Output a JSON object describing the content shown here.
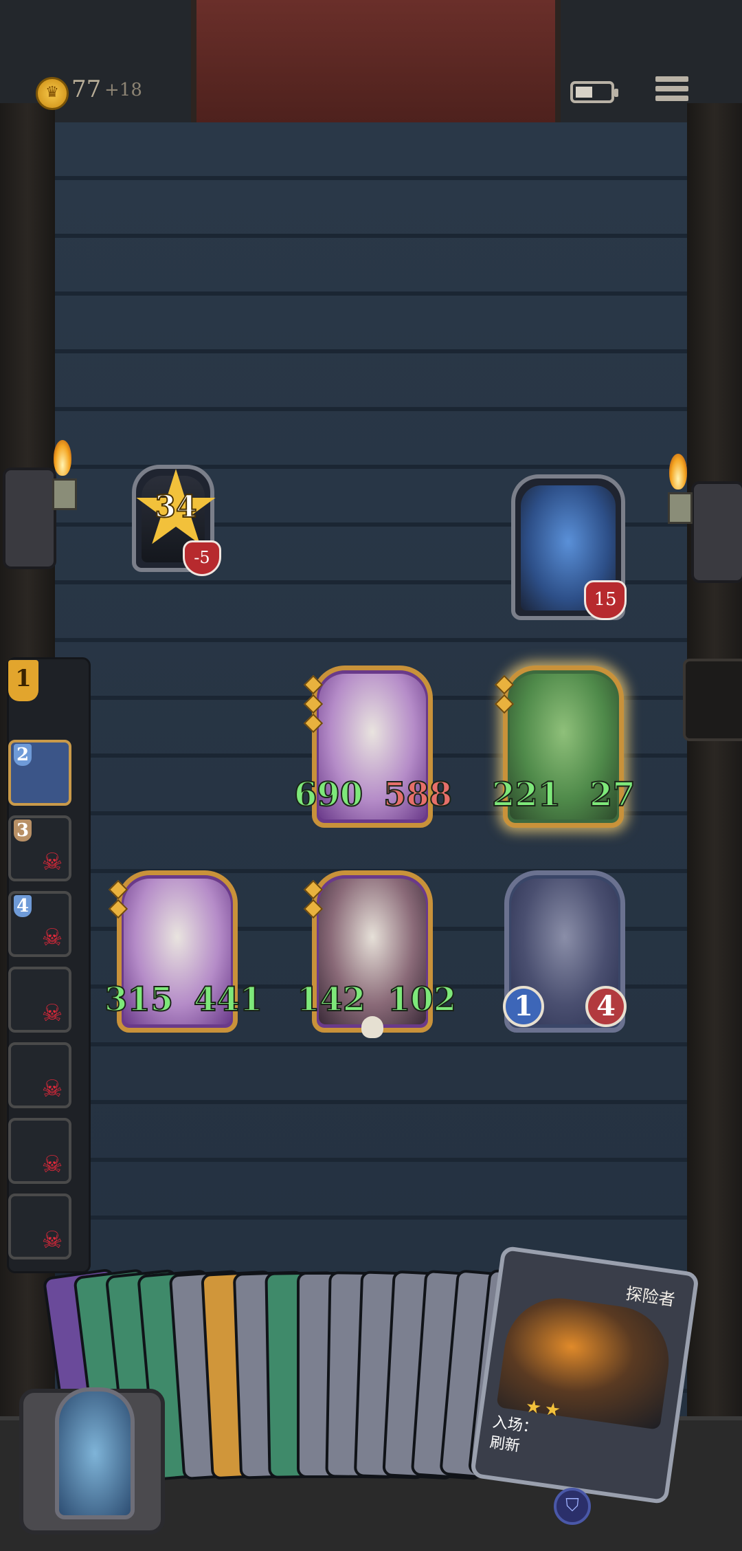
{
  "hud": {
    "gold": "77",
    "gold_delta": "+18",
    "battery_level": 0.5,
    "coin_icon": "crown-coin-icon",
    "menu_icon": "menu-icon"
  },
  "enemies": [
    {
      "name": "enemy-hooded",
      "star_value": "34",
      "heart": "-5"
    },
    {
      "name": "enemy-blue-ogre",
      "heart": "15"
    }
  ],
  "units": [
    {
      "id": "pumpkin-stack-1",
      "attack": "690",
      "health": "588",
      "style": "stat-text"
    },
    {
      "id": "green-bird",
      "attack": "221",
      "health": "27",
      "style": "stat-text"
    },
    {
      "id": "pumpkin-stack-2",
      "attack": "315",
      "health": "441",
      "style": "stat-text"
    },
    {
      "id": "masked-rabbit",
      "attack": "142",
      "health": "102",
      "style": "stat-text"
    },
    {
      "id": "gray-rat",
      "attack": "1",
      "health": "4",
      "style": "orbs"
    }
  ],
  "turn_queue": {
    "current": "1",
    "slots": [
      {
        "num": "2",
        "dead": false
      },
      {
        "num": "3",
        "dead": true
      },
      {
        "num": "4",
        "dead": true
      },
      {
        "num": "",
        "dead": true
      },
      {
        "num": "",
        "dead": true
      },
      {
        "num": "",
        "dead": true
      },
      {
        "num": "",
        "dead": true
      }
    ],
    "skull_glyph": "☠"
  },
  "hand": {
    "featured_card": {
      "title": "探险者",
      "text_line1": "入场：",
      "text_line2": "刷新"
    }
  },
  "colors": {
    "gold": "#f2c13b",
    "attack_green": "#7ee87a",
    "health_red": "#e66f6a",
    "card_frame_gold": "#c9923a",
    "wall": "#2a3848"
  }
}
